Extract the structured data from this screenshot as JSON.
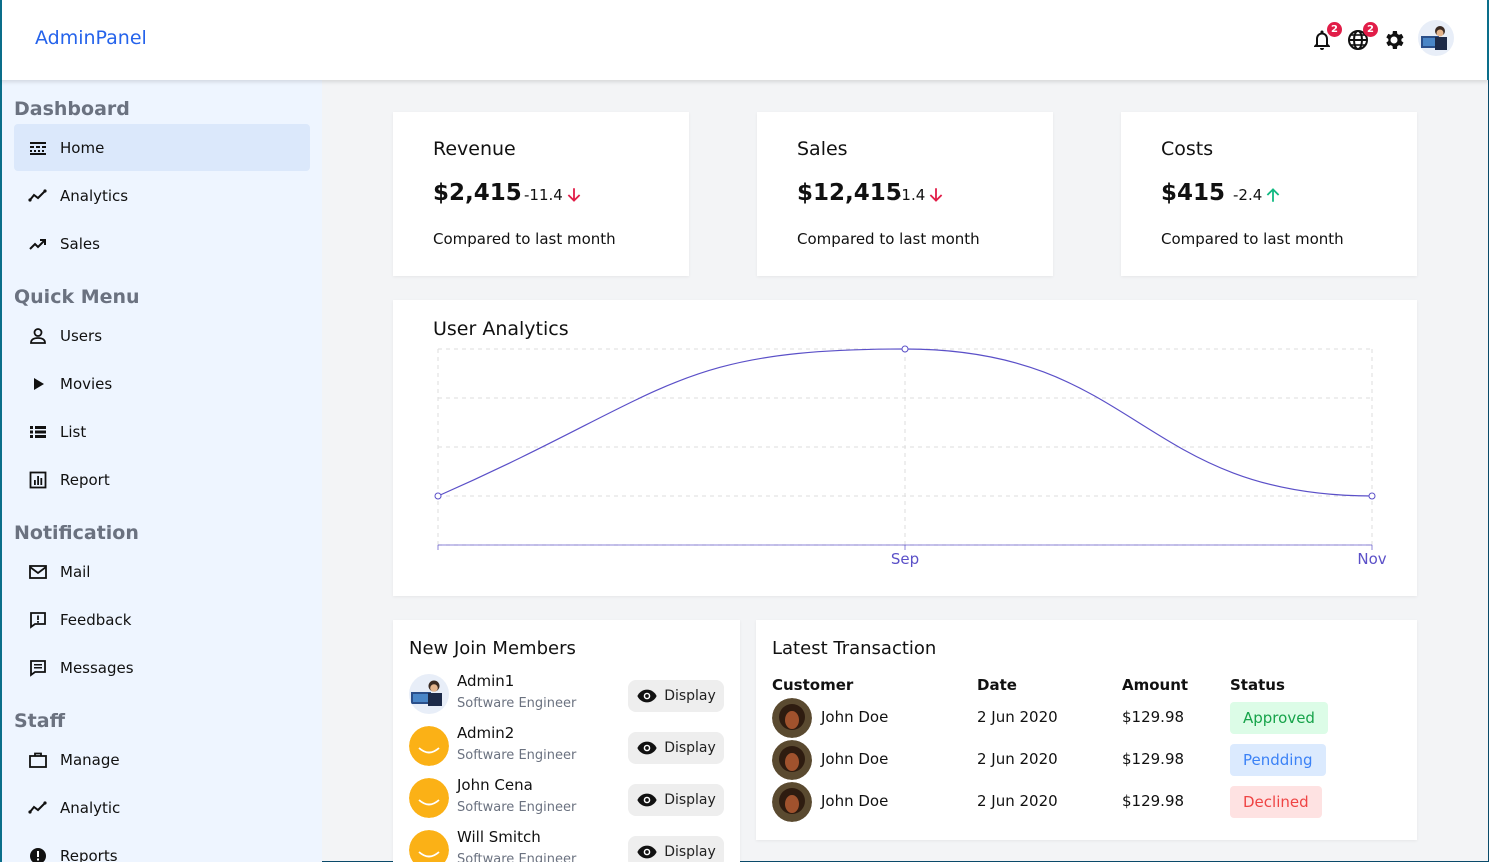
{
  "app": {
    "logo": "AdminPanel"
  },
  "topbar": {
    "notifications_count": "2",
    "language_count": "2"
  },
  "sidebar": {
    "sections": [
      {
        "title": "Dashboard",
        "items": [
          "Home",
          "Analytics",
          "Sales"
        ]
      },
      {
        "title": "Quick Menu",
        "items": [
          "Users",
          "Movies",
          "List",
          "Report"
        ]
      },
      {
        "title": "Notification",
        "items": [
          "Mail",
          "Feedback",
          "Messages"
        ]
      },
      {
        "title": "Staff",
        "items": [
          "Manage",
          "Analytic",
          "Reports"
        ]
      }
    ],
    "active_item": "Home"
  },
  "stats": [
    {
      "title": "Revenue",
      "value": "$2,415",
      "delta": "-11.4",
      "trend": "down",
      "subtitle": "Compared to last month"
    },
    {
      "title": "Sales",
      "value": "$12,415",
      "delta": "-1.4",
      "trend": "down",
      "subtitle": "Compared to last month"
    },
    {
      "title": "Costs",
      "value": "$415",
      "delta": "-2.4",
      "trend": "up",
      "subtitle": "Compared to last month"
    }
  ],
  "analytics": {
    "title": "User Analytics"
  },
  "chart_data": {
    "type": "line",
    "title": "User Analytics",
    "x": [
      "",
      "Sep",
      "Nov"
    ],
    "series": [
      {
        "values": [
          1,
          4,
          1
        ]
      }
    ],
    "xlabel": "",
    "ylabel": "",
    "grid": true,
    "line_color": "#5b50c8"
  },
  "members": {
    "title": "New Join Members",
    "items": [
      {
        "name": "Admin1",
        "role": "Software Engineer",
        "action": "Display",
        "avatar": "photo"
      },
      {
        "name": "Admin2",
        "role": "Software Engineer",
        "action": "Display",
        "avatar": "smiley"
      },
      {
        "name": "John Cena",
        "role": "Software Engineer",
        "action": "Display",
        "avatar": "smiley"
      },
      {
        "name": "Will Smitch",
        "role": "Software Engineer",
        "action": "Display",
        "avatar": "smiley"
      }
    ]
  },
  "transactions": {
    "title": "Latest Transaction",
    "headers": [
      "Customer",
      "Date",
      "Amount",
      "Status"
    ],
    "rows": [
      {
        "customer": "John Doe",
        "date": "2 Jun 2020",
        "amount": "$129.98",
        "status": "Approved"
      },
      {
        "customer": "John Doe",
        "date": "2 Jun 2020",
        "amount": "$129.98",
        "status": "Pendding"
      },
      {
        "customer": "John Doe",
        "date": "2 Jun 2020",
        "amount": "$129.98",
        "status": "Declined"
      }
    ]
  },
  "colors": {
    "accent": "#2563eb",
    "sidebar_bg": "#eef5ff",
    "sidebar_active": "#dbe8fb",
    "down": "#e11d48",
    "up": "#10b981",
    "approved_bg": "#dcfce7",
    "approved_fg": "#16a34a",
    "pending_bg": "#dbeafe",
    "pending_fg": "#3b82f6",
    "declined_bg": "#fee2e2",
    "declined_fg": "#ef4444"
  }
}
